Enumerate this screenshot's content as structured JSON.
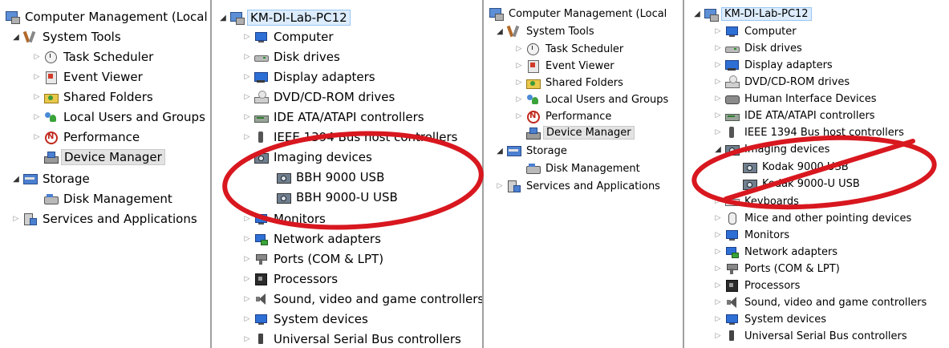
{
  "left_panel_1": {
    "root": "Computer Management (Local",
    "system_tools": "System Tools",
    "task_scheduler": "Task Scheduler",
    "event_viewer": "Event Viewer",
    "shared_folders": "Shared Folders",
    "local_users": "Local Users and Groups",
    "performance": "Performance",
    "device_manager": "Device Manager",
    "storage": "Storage",
    "disk_management": "Disk Management",
    "services": "Services and Applications"
  },
  "device_panel_1": {
    "root": "KM-DI-Lab-PC12",
    "computer": "Computer",
    "disk_drives": "Disk drives",
    "display_adapters": "Display adapters",
    "dvd": "DVD/CD-ROM drives",
    "ide": "IDE ATA/ATAPI controllers",
    "ieee1394": "IEEE 1394 Bus host controllers",
    "imaging": "Imaging devices",
    "bbh9000": "BBH 9000 USB",
    "bbh9000u": "BBH 9000-U USB",
    "monitors": "Monitors",
    "network": "Network adapters",
    "ports": "Ports (COM & LPT)",
    "processors": "Processors",
    "sound": "Sound, video and game controllers",
    "system_devices": "System devices",
    "usb": "Universal Serial Bus controllers"
  },
  "left_panel_2": {
    "root": "Computer Management (Local",
    "system_tools": "System Tools",
    "task_scheduler": "Task Scheduler",
    "event_viewer": "Event Viewer",
    "shared_folders": "Shared Folders",
    "local_users": "Local Users and Groups",
    "performance": "Performance",
    "device_manager": "Device Manager",
    "storage": "Storage",
    "disk_management": "Disk Management",
    "services": "Services and Applications"
  },
  "device_panel_2": {
    "root": "KM-DI-Lab-PC12",
    "computer": "Computer",
    "disk_drives": "Disk drives",
    "display_adapters": "Display adapters",
    "dvd": "DVD/CD-ROM drives",
    "hid": "Human Interface Devices",
    "ide": "IDE ATA/ATAPI controllers",
    "ieee1394": "IEEE 1394 Bus host controllers",
    "imaging": "Imaging devices",
    "kodak9000": "Kodak 9000 USB",
    "kodak9000u": "Kodak 9000-U USB",
    "keyboards": "Keyboards",
    "mice": "Mice and other pointing devices",
    "monitors": "Monitors",
    "network": "Network adapters",
    "ports": "Ports (COM & LPT)",
    "processors": "Processors",
    "sound": "Sound, video and game controllers",
    "system_devices": "System devices",
    "usb": "Universal Serial Bus controllers"
  },
  "colors": {
    "annotation_red": "#d8171f",
    "selection_grey": "#e3e3e3",
    "root_highlight": "#dcecfc"
  }
}
